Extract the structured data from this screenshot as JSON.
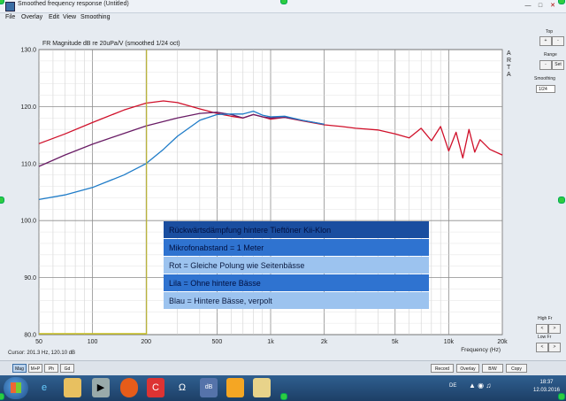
{
  "window": {
    "title": "Smoothed frequency response (Untitled)"
  },
  "menu": [
    "File",
    "Overlay",
    "Edit",
    "View",
    "Smoothing"
  ],
  "plot": {
    "header": "FR Magnitude dB re 20uPa/V (smoothed 1/24 oct)",
    "brand": [
      "A",
      "R",
      "T",
      "A"
    ],
    "cursor_readout": "Cursor: 201.3 Hz, 120.10 dB"
  },
  "chart_data": {
    "type": "line",
    "title": "FR Magnitude dB re 20uPa/V (smoothed 1/24 oct)",
    "xlabel": "Frequency (Hz)",
    "ylabel": "",
    "xscale": "log",
    "xlim": [
      50,
      20000
    ],
    "ylim": [
      80,
      130
    ],
    "xticks": [
      50,
      100,
      200,
      500,
      1000,
      2000,
      5000,
      10000,
      20000
    ],
    "xtick_labels": [
      "50",
      "100",
      "200",
      "500",
      "1k",
      "2k",
      "5k",
      "10k",
      "20k"
    ],
    "yticks": [
      80,
      90,
      100,
      110,
      120,
      130
    ],
    "ytick_labels": [
      "80.0",
      "90.0",
      "100.0",
      "110.0",
      "120.0",
      "130.0"
    ],
    "grid": true,
    "cursor_x": 201.3,
    "series": [
      {
        "color": "#d0102a",
        "x": [
          50,
          70,
          100,
          150,
          200,
          250,
          300,
          400,
          500,
          600,
          700,
          800,
          900,
          1000,
          1200,
          1500,
          2000,
          2500,
          3000,
          4000,
          5000,
          6000,
          7000,
          8000,
          9000,
          10000,
          11000,
          12000,
          13000,
          14000,
          15000,
          17000,
          20000
        ],
        "values": [
          113.5,
          115.2,
          117.2,
          119.4,
          120.6,
          121.0,
          120.7,
          119.6,
          118.8,
          118.3,
          118.0,
          118.6,
          118.2,
          117.8,
          118.1,
          117.5,
          116.8,
          116.5,
          116.2,
          115.9,
          115.2,
          114.5,
          116.2,
          114.0,
          116.5,
          112.2,
          115.5,
          111.0,
          116.0,
          112.0,
          114.2,
          112.5,
          111.5
        ]
      },
      {
        "color": "#6a1d66",
        "x": [
          50,
          70,
          100,
          150,
          200,
          300,
          400,
          500,
          600,
          700,
          800,
          900,
          1000,
          1200,
          1500,
          2000
        ],
        "values": [
          109.5,
          111.5,
          113.4,
          115.3,
          116.6,
          118.0,
          118.8,
          119.0,
          118.6,
          118.0,
          118.6,
          118.2,
          118.0,
          118.1,
          117.6,
          116.9
        ]
      },
      {
        "color": "#1f7cc8",
        "x": [
          50,
          70,
          100,
          150,
          200,
          250,
          300,
          400,
          500,
          600,
          700,
          800,
          900,
          1000,
          1200,
          1500,
          2000
        ],
        "values": [
          103.7,
          104.5,
          105.8,
          108.0,
          110.0,
          112.5,
          114.8,
          117.6,
          118.6,
          118.7,
          118.7,
          119.2,
          118.5,
          118.2,
          118.3,
          117.6,
          116.9
        ]
      }
    ]
  },
  "legend": [
    "Rückwärtsdämpfung hintere Tieftöner Kii-Klon",
    "Mikrofonabstand =  1 Meter",
    "Rot = Gleiche Polung wie Seitenbässe",
    "Lila = Ohne hintere Bässe",
    "Blau = Hintere Bässe, verpolt"
  ],
  "side": {
    "top_label": "Top",
    "range_label": "Range",
    "set_label": "Set",
    "smoothing_label": "Smoothing",
    "smoothing_value": "1/24",
    "highfr_label": "High Fr",
    "lowfr_label": "Low Fr",
    "up": "+",
    "down": "-",
    "left": "<",
    "right": ">"
  },
  "bottom_buttons_left": [
    "Mag",
    "M+P",
    "Ph",
    "Gd"
  ],
  "bottom_buttons_right": [
    "Record",
    "Overlay",
    "B/W",
    "Copy"
  ],
  "clock": {
    "time": "18:37",
    "date": "12.03.2016"
  },
  "tray_lang": "DE",
  "colors": {
    "accent": "#3a6ea5",
    "legend_dark": "#1a4ea0",
    "legend_mid": "#2f73d0",
    "legend_light": "#9cc3ef"
  }
}
